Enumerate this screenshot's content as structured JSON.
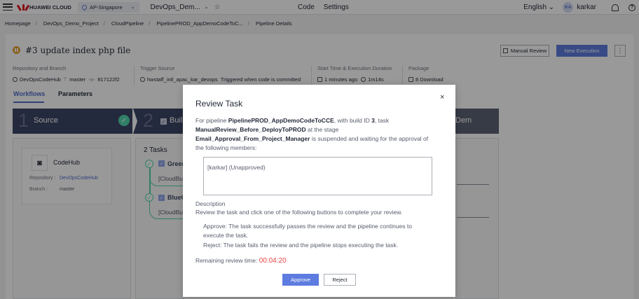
{
  "header": {
    "logo_text": "HUAWEI CLOUD",
    "region": "AP-Singapore",
    "project": "DevOps_Dem...",
    "nav": [
      "Code",
      "Settings"
    ],
    "language": "English",
    "avatar_initials": "KA",
    "username": "karkar"
  },
  "breadcrumb": [
    "Homepage",
    "DevOps_Demo_Project",
    "CloudPipeline",
    "PipelinePROD_AppDemoCodeToC...",
    "Pipeline Details"
  ],
  "run": {
    "title": "#3  update index php file",
    "status_color": "#e5a033",
    "manual_review_label": "Manual Review",
    "new_execution_label": "New Execution",
    "more_label": "⋮"
  },
  "info": {
    "repo_label": "Repository and Branch",
    "repo_name": "DevOpsCodeHub",
    "branch": "master",
    "commit": "817122f2",
    "trigger_label": "Trigger Source",
    "trigger_user": "hwstaff_intl_apac_kar_devops",
    "trigger_text": "Triggered when code is committed",
    "time_label": "Start Time & Execution Duration",
    "start_time": "1 minutes ago",
    "duration": "1m14s",
    "package_label": "Package",
    "package_text": "8 Download"
  },
  "tabs": [
    "Workflows",
    "Parameters"
  ],
  "stages": [
    {
      "num": "1",
      "name": "Source"
    },
    {
      "num": "2",
      "name": "Buil"
    },
    {
      "num": "",
      "name": "Dem"
    }
  ],
  "codehub": {
    "name": "CodeHub",
    "repo_label": "Repository :",
    "repo_value": "DevOpsCodeHub",
    "branch_label": "Branch :",
    "branch_value": "master"
  },
  "tasks": {
    "title": "2 Tasks",
    "items": [
      {
        "name": "Greer",
        "sub": "[CloudBu"
      },
      {
        "name": "BlueC",
        "sub": "[CloudBu"
      }
    ]
  },
  "modal": {
    "title": "Review Task",
    "close": "×",
    "intro_1": "For pipeline ",
    "pipeline_name": "PipelinePROD_AppDemoCodeToCCE",
    "intro_2": ", with build ID ",
    "build_id": "3",
    "intro_3": ", task",
    "task_name": "ManualReview_Before_DeployToPROD",
    "intro_4": " at the stage",
    "stage_name": "Email_Approval_From_Project_Manager",
    "intro_5": " is suspended and waiting for the approval of the following members:",
    "members": "[karkar]  (Unapproved)",
    "description_heading": "Description",
    "description": "Review the task and click one of the following buttons to complete your review.",
    "approve_desc": "Approve:  The task successfully passes the review and the pipeline continues to execute the task.",
    "reject_desc": "Reject:  The task fails the review and the pipeline stops executing the task.",
    "remaining_label": "Remaining review time: ",
    "remaining_value": "00:04:20",
    "approve_label": "Approve",
    "reject_label": "Reject"
  }
}
